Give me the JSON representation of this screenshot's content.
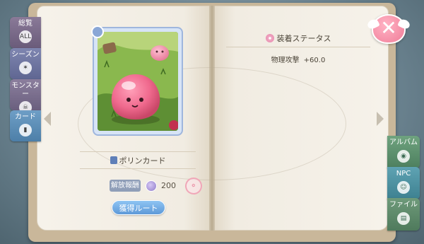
{
  "left_tabs": [
    {
      "label": "総覧",
      "icon": "ALL"
    },
    {
      "label": "シーズン",
      "icon": "✶"
    },
    {
      "label": "モンスター",
      "icon": "☠"
    },
    {
      "label": "カード",
      "icon": "▮"
    }
  ],
  "right_tabs": [
    {
      "label": "アルバム",
      "icon": "◉"
    },
    {
      "label": "NPC",
      "icon": "☺"
    },
    {
      "label": "ファイル",
      "icon": "▤"
    }
  ],
  "card": {
    "name": "ポリンカード",
    "reward_label": "解放報酬",
    "reward_value": "200",
    "route_button": "獲得ルート"
  },
  "status": {
    "header": "装着ステータス",
    "stats": [
      {
        "label": "物理攻撃",
        "value": "+60.0"
      }
    ]
  },
  "colors": {
    "poring_pink": "#f06a8e",
    "route_button": "#5d99d8",
    "close_button": "#f07c98"
  },
  "icons": {
    "close": "close-icon",
    "reward_currency": "coin-icon",
    "stamp": "stamp-icon"
  }
}
